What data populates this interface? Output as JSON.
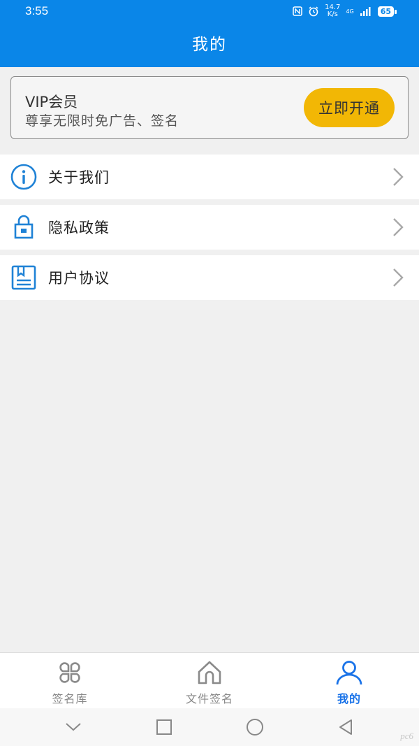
{
  "status_bar": {
    "time": "3:55",
    "net_speed_value": "14.7",
    "net_speed_unit": "K/s",
    "signal": "4G",
    "battery": "65"
  },
  "header": {
    "title": "我的"
  },
  "vip": {
    "title": "VIP会员",
    "description": "尊享无限时免广告、签名",
    "button_label": "立即开通"
  },
  "menu": [
    {
      "label": "关于我们",
      "icon": "info-icon"
    },
    {
      "label": "隐私政策",
      "icon": "lock-icon"
    },
    {
      "label": "用户协议",
      "icon": "document-icon"
    }
  ],
  "tabs": [
    {
      "label": "签名库",
      "icon": "grid-icon",
      "active": false
    },
    {
      "label": "文件签名",
      "icon": "home-icon",
      "active": false
    },
    {
      "label": "我的",
      "icon": "user-icon",
      "active": true
    }
  ],
  "watermark": "pc6",
  "colors": {
    "header_bg": "#0a86e8",
    "vip_button": "#f2b705",
    "active_tab": "#1a73e8",
    "icon_blue": "#1f82d6"
  }
}
